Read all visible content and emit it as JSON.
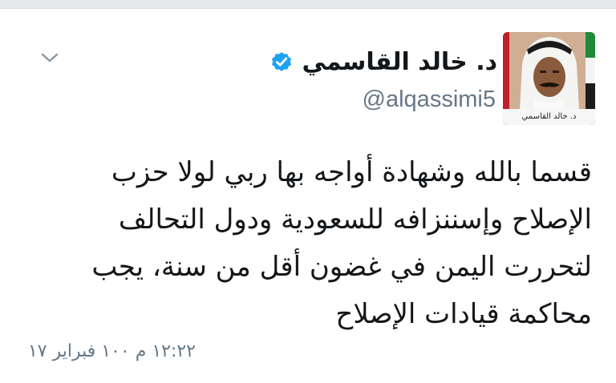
{
  "tweet": {
    "author": {
      "display_name": "د. خالد القاسمي",
      "handle": "@alqassimi5",
      "verified": true,
      "avatar_caption": "د. خالد القاسمي"
    },
    "text_lines": [
      "قسما بالله وشهادة أواجه بها ربي لولا حزب",
      "الإصلاح وإسننزافه للسعودية ودول التحالف",
      "لتحررت اليمن في غضون أقل من سنة، يجب",
      "محاكمة قيادات الإصلاح"
    ],
    "timestamp": "١٢:٢٢ م ١٠٠ فبراير ١٧"
  },
  "icons": {
    "menu": "chevron-down-icon",
    "verified": "verified-badge-icon"
  },
  "colors": {
    "verified_blue": "#1da1f2",
    "secondary_text": "#657786",
    "primary_text": "#14171a"
  }
}
